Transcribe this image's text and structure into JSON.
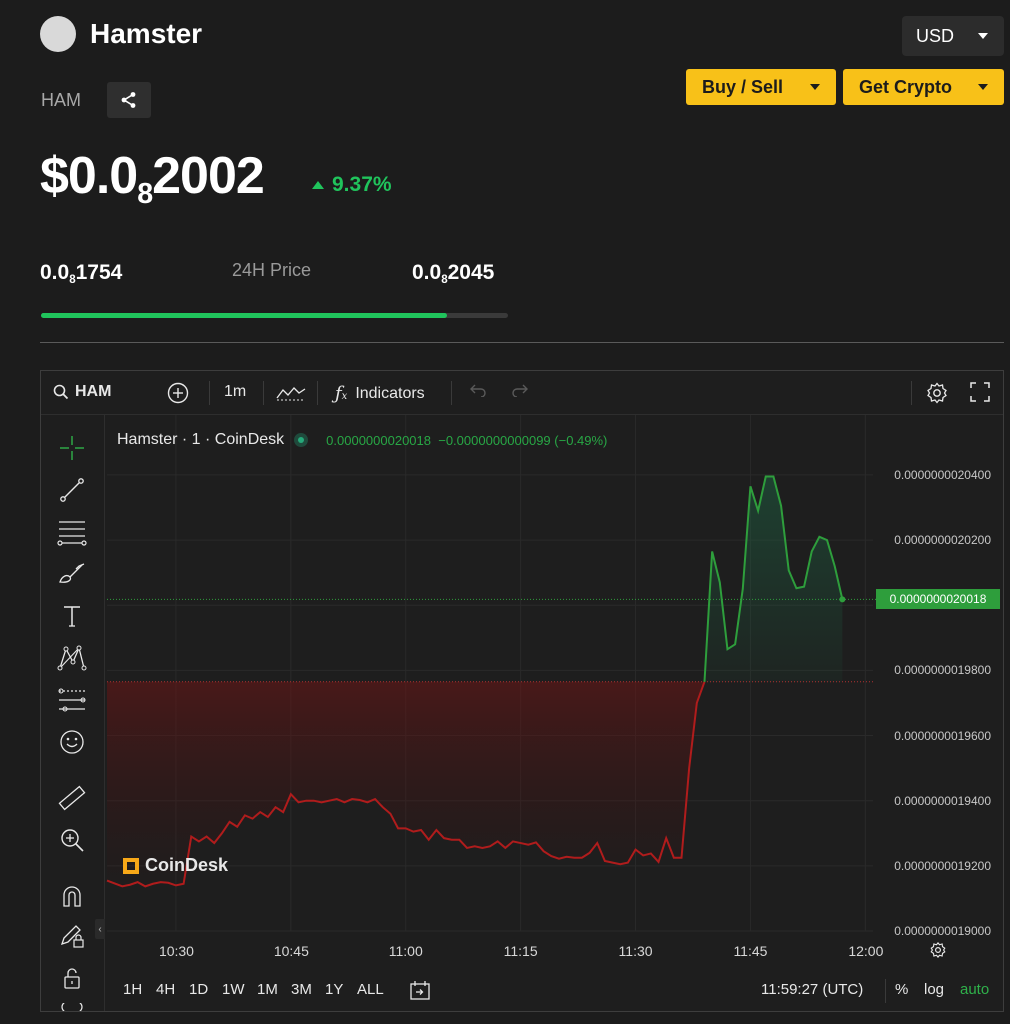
{
  "coin": {
    "name": "Hamster",
    "symbol": "HAM",
    "price_prefix": "$0.0",
    "price_zero_count": "8",
    "price_digits": "2002",
    "change": "9.37%"
  },
  "currency": {
    "selected": "USD"
  },
  "actions": {
    "buy_sell": "Buy / Sell",
    "get_crypto": "Get Crypto"
  },
  "range_24h": {
    "label": "24H Price",
    "low_prefix": "0.0",
    "low_zeros": "8",
    "low_digits": "1754",
    "high_prefix": "0.0",
    "high_zeros": "8",
    "high_digits": "2045",
    "position_fraction": 0.87
  },
  "chart_toolbar": {
    "symbol": "HAM",
    "interval": "1m",
    "indicators": "Indicators"
  },
  "legend": {
    "title": "Hamster · 1 · CoinDesk",
    "last": "0.0000000020018",
    "change": "−0.0000000000099 (−0.49%)"
  },
  "watermark": "CoinDesk",
  "current_price_tag": "0.0000000020018",
  "bottom_bar": {
    "ranges": [
      "1H",
      "4H",
      "1D",
      "1W",
      "1M",
      "3M",
      "1Y",
      "ALL"
    ],
    "clock": "11:59:27 (UTC)",
    "percent": "%",
    "log": "log",
    "auto": "auto"
  },
  "colors": {
    "accent": "#f8c118",
    "up": "#20c45c",
    "down": "#b01c1c",
    "background": "#1c1c1c"
  },
  "chart_data": {
    "type": "line",
    "baseline": 1.9765e-09,
    "ylim": [
      1.9e-09,
      2.0455e-09
    ],
    "y_ticks": [
      "0.0000000020400",
      "0.0000000020200",
      "0.0000000020000",
      "0.0000000019800",
      "0.0000000019600",
      "0.0000000019400",
      "0.0000000019200",
      "0.0000000019000"
    ],
    "x_ticks": [
      "10:30",
      "10:45",
      "11:00",
      "11:15",
      "11:30",
      "11:45",
      "12:00"
    ],
    "x_range": [
      "10:21",
      "12:01"
    ],
    "series": [
      {
        "x": [
          "10:21",
          "10:23",
          "10:24",
          "10:25",
          "10:26",
          "10:27",
          "10:28",
          "10:29",
          "10:30",
          "10:31",
          "10:32",
          "10:33",
          "10:34",
          "10:35",
          "10:36",
          "10:37",
          "10:38",
          "10:39",
          "10:40",
          "10:41",
          "10:42",
          "10:43",
          "10:44",
          "10:45",
          "10:46",
          "10:47",
          "10:48",
          "10:49",
          "10:50",
          "10:51",
          "10:52",
          "10:53",
          "10:54",
          "10:55",
          "10:56",
          "10:57",
          "10:58",
          "10:59",
          "11:00",
          "11:01",
          "11:02",
          "11:03",
          "11:04",
          "11:05",
          "11:06",
          "11:07",
          "11:08",
          "11:09",
          "11:10",
          "11:11",
          "11:12",
          "11:13",
          "11:14",
          "11:15",
          "11:16",
          "11:17",
          "11:18",
          "11:19",
          "11:20",
          "11:21",
          "11:22",
          "11:23",
          "11:24",
          "11:25",
          "11:26",
          "11:27",
          "11:28",
          "11:29",
          "11:30",
          "11:31",
          "11:32",
          "11:33",
          "11:34",
          "11:35",
          "11:36",
          "11:37",
          "11:38",
          "11:39",
          "11:40",
          "11:41",
          "11:42",
          "11:43",
          "11:44",
          "11:45",
          "11:46",
          "11:47",
          "11:48",
          "11:49",
          "11:50",
          "11:51",
          "11:52",
          "11:53",
          "11:54",
          "11:55",
          "11:56",
          "11:57"
        ],
        "y": [
          1.9155e-09,
          1.9137e-09,
          1.9142e-09,
          1.915e-09,
          1.9137e-09,
          1.9145e-09,
          1.915e-09,
          1.9148e-09,
          1.914e-09,
          1.9145e-09,
          1.929e-09,
          1.9275e-09,
          1.929e-09,
          1.927e-09,
          1.93e-09,
          1.9335e-09,
          1.932e-09,
          1.9355e-09,
          1.9345e-09,
          1.9365e-09,
          1.935e-09,
          1.938e-09,
          1.9365e-09,
          1.942e-09,
          1.9395e-09,
          1.94e-09,
          1.94e-09,
          1.9395e-09,
          1.94e-09,
          1.9405e-09,
          1.9395e-09,
          1.9405e-09,
          1.9402e-09,
          1.9395e-09,
          1.9405e-09,
          1.938e-09,
          1.936e-09,
          1.9315e-09,
          1.9315e-09,
          1.9305e-09,
          1.931e-09,
          1.928e-09,
          1.931e-09,
          1.9285e-09,
          1.928e-09,
          1.928e-09,
          1.9255e-09,
          1.926e-09,
          1.9255e-09,
          1.926e-09,
          1.9275e-09,
          1.9255e-09,
          1.9275e-09,
          1.927e-09,
          1.9265e-09,
          1.9272e-09,
          1.9245e-09,
          1.923e-09,
          1.9222e-09,
          1.9228e-09,
          1.9225e-09,
          1.9225e-09,
          1.924e-09,
          1.927e-09,
          1.9215e-09,
          1.921e-09,
          1.9205e-09,
          1.921e-09,
          1.925e-09,
          1.9232e-09,
          1.9238e-09,
          1.9212e-09,
          1.9285e-09,
          1.9225e-09,
          1.9225e-09,
          1.95e-09,
          1.97e-09,
          1.9765e-09,
          2.0165e-09,
          2.007e-09,
          1.9865e-09,
          1.988e-09,
          2.005e-09,
          2.0365e-09,
          2.029e-09,
          2.0395e-09,
          2.0395e-09,
          2.0305e-09,
          2.0107e-09,
          2.0052e-09,
          2.0057e-09,
          2.0165e-09,
          2.021e-09,
          2.02e-09,
          2.012e-09,
          2.0018e-09
        ]
      }
    ]
  }
}
